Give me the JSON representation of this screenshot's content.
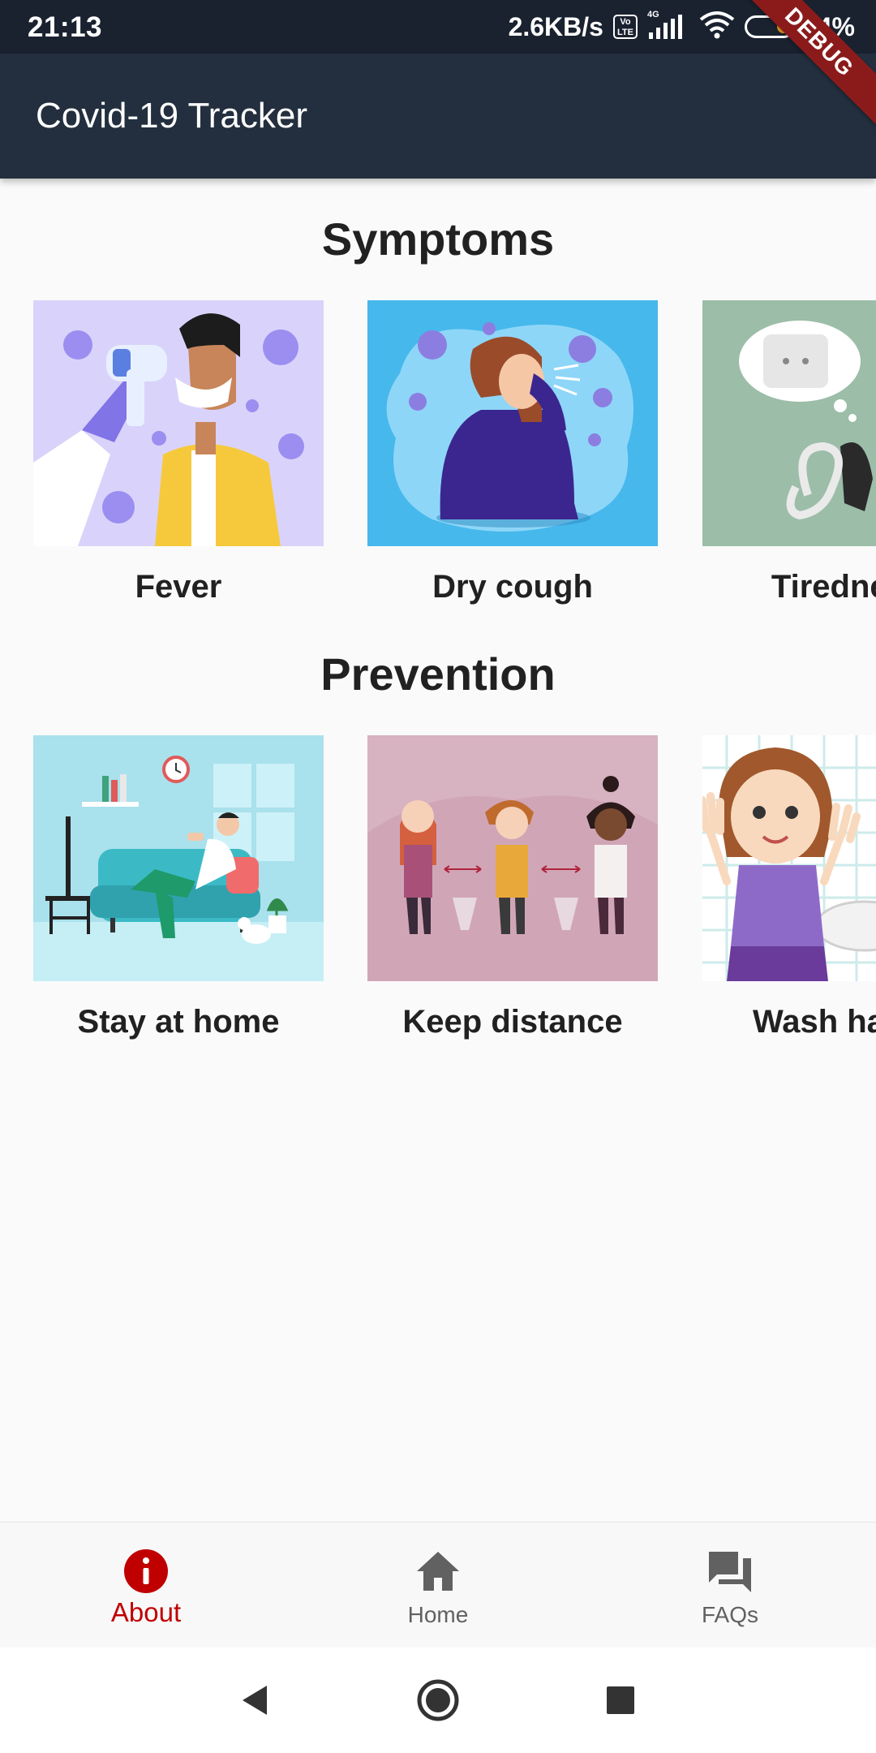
{
  "status_bar": {
    "time": "21:13",
    "net_speed": "2.6KB/s",
    "volte_top": "Vo",
    "volte_bottom": "LTE",
    "network": "4G",
    "battery": "44%"
  },
  "debug_banner": "DEBUG",
  "app_bar": {
    "title": "Covid-19 Tracker"
  },
  "symptoms": {
    "title": "Symptoms",
    "items": [
      {
        "label": "Fever"
      },
      {
        "label": "Dry cough"
      },
      {
        "label": "Tiredness"
      }
    ]
  },
  "prevention": {
    "title": "Prevention",
    "items": [
      {
        "label": "Stay at home"
      },
      {
        "label": "Keep distance"
      },
      {
        "label": "Wash hands"
      }
    ]
  },
  "bottom_nav": {
    "items": [
      {
        "label": "About",
        "icon": "info-icon",
        "active": true
      },
      {
        "label": "Home",
        "icon": "home-icon",
        "active": false
      },
      {
        "label": "FAQs",
        "icon": "chat-bubbles-icon",
        "active": false
      }
    ],
    "active_color": "#c00000",
    "inactive_color": "#616161"
  },
  "system_nav": {
    "buttons": [
      "back-icon",
      "home-circle-icon",
      "recents-icon"
    ]
  },
  "colors": {
    "status_bar_bg": "#1a2230",
    "app_bar_bg": "#232f3e",
    "page_bg": "#fafafa"
  }
}
